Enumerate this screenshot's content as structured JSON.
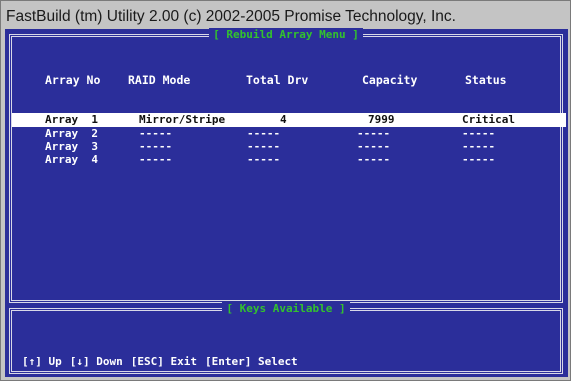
{
  "window": {
    "title": "FastBuild (tm) Utility 2.00 (c) 2002-2005 Promise Technology, Inc."
  },
  "panels": {
    "main_title": "[ Rebuild Array Menu ]",
    "keys_title": "[ Keys Available ]"
  },
  "table": {
    "headers": {
      "array_no": "Array No",
      "raid_mode": "RAID Mode",
      "total_drv": "Total Drv",
      "capacity": "Capacity",
      "status": "Status"
    },
    "rows": [
      {
        "array_no": "Array  1",
        "raid_mode": "Mirror/Stripe",
        "total_drv": "4",
        "capacity": "7999",
        "status": "Critical"
      },
      {
        "array_no": "Array  2",
        "raid_mode": "-----",
        "total_drv": "-----",
        "capacity": "-----",
        "status": "-----"
      },
      {
        "array_no": "Array  3",
        "raid_mode": "-----",
        "total_drv": "-----",
        "capacity": "-----",
        "status": "-----"
      },
      {
        "array_no": "Array  4",
        "raid_mode": "-----",
        "total_drv": "-----",
        "capacity": "-----",
        "status": "-----"
      }
    ],
    "selected_row": 0
  },
  "keys": {
    "up": "[↑] Up",
    "down": "[↓] Down",
    "exit": "[ESC] Exit",
    "select": "[Enter] Select"
  },
  "colors": {
    "screen_bg": "#2b2e9a",
    "panel_title": "#33c22e",
    "text": "#ffffff",
    "selection_bg": "#ffffff"
  }
}
